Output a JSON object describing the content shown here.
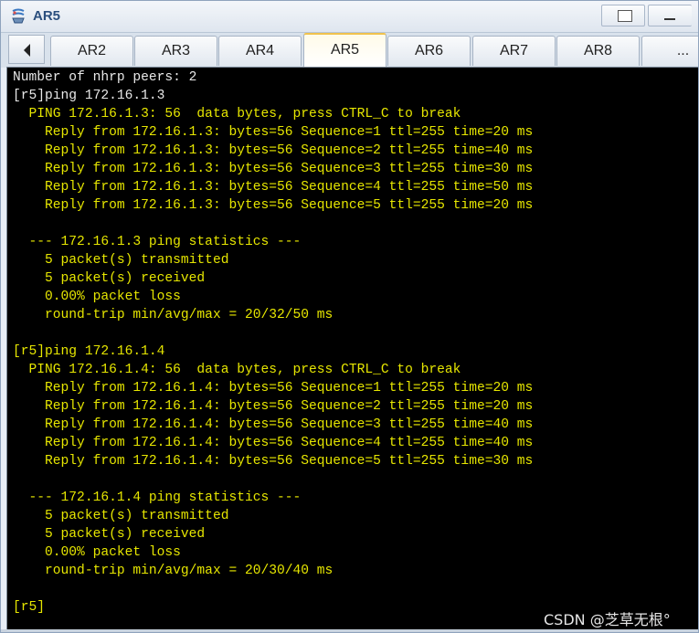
{
  "window": {
    "title": "AR5",
    "accent_color": "#f0c24d",
    "title_color": "#2b4f7e"
  },
  "tabs": [
    {
      "label": "AR2",
      "active": false
    },
    {
      "label": "AR3",
      "active": false
    },
    {
      "label": "AR4",
      "active": false
    },
    {
      "label": "AR5",
      "active": true
    },
    {
      "label": "AR6",
      "active": false
    },
    {
      "label": "AR7",
      "active": false
    },
    {
      "label": "AR8",
      "active": false
    },
    {
      "label": "...",
      "active": false
    }
  ],
  "terminal": {
    "background": "#000000",
    "lines": [
      {
        "text": "Number of nhrp peers: 2",
        "color": "white"
      },
      {
        "text": "[r5]ping 172.16.1.3",
        "color": "white"
      },
      {
        "text": "  PING 172.16.1.3: 56  data bytes, press CTRL_C to break",
        "color": "yellow"
      },
      {
        "text": "    Reply from 172.16.1.3: bytes=56 Sequence=1 ttl=255 time=20 ms",
        "color": "yellow"
      },
      {
        "text": "    Reply from 172.16.1.3: bytes=56 Sequence=2 ttl=255 time=40 ms",
        "color": "yellow"
      },
      {
        "text": "    Reply from 172.16.1.3: bytes=56 Sequence=3 ttl=255 time=30 ms",
        "color": "yellow"
      },
      {
        "text": "    Reply from 172.16.1.3: bytes=56 Sequence=4 ttl=255 time=50 ms",
        "color": "yellow"
      },
      {
        "text": "    Reply from 172.16.1.3: bytes=56 Sequence=5 ttl=255 time=20 ms",
        "color": "yellow"
      },
      {
        "text": "",
        "color": "yellow"
      },
      {
        "text": "  --- 172.16.1.3 ping statistics ---",
        "color": "yellow"
      },
      {
        "text": "    5 packet(s) transmitted",
        "color": "yellow"
      },
      {
        "text": "    5 packet(s) received",
        "color": "yellow"
      },
      {
        "text": "    0.00% packet loss",
        "color": "yellow"
      },
      {
        "text": "    round-trip min/avg/max = 20/32/50 ms",
        "color": "yellow"
      },
      {
        "text": "",
        "color": "yellow"
      },
      {
        "text": "[r5]ping 172.16.1.4",
        "color": "yellow"
      },
      {
        "text": "  PING 172.16.1.4: 56  data bytes, press CTRL_C to break",
        "color": "yellow"
      },
      {
        "text": "    Reply from 172.16.1.4: bytes=56 Sequence=1 ttl=255 time=20 ms",
        "color": "yellow"
      },
      {
        "text": "    Reply from 172.16.1.4: bytes=56 Sequence=2 ttl=255 time=20 ms",
        "color": "yellow"
      },
      {
        "text": "    Reply from 172.16.1.4: bytes=56 Sequence=3 ttl=255 time=40 ms",
        "color": "yellow"
      },
      {
        "text": "    Reply from 172.16.1.4: bytes=56 Sequence=4 ttl=255 time=40 ms",
        "color": "yellow"
      },
      {
        "text": "    Reply from 172.16.1.4: bytes=56 Sequence=5 ttl=255 time=30 ms",
        "color": "yellow"
      },
      {
        "text": "",
        "color": "yellow"
      },
      {
        "text": "  --- 172.16.1.4 ping statistics ---",
        "color": "yellow"
      },
      {
        "text": "    5 packet(s) transmitted",
        "color": "yellow"
      },
      {
        "text": "    5 packet(s) received",
        "color": "yellow"
      },
      {
        "text": "    0.00% packet loss",
        "color": "yellow"
      },
      {
        "text": "    round-trip min/avg/max = 20/30/40 ms",
        "color": "yellow"
      },
      {
        "text": "",
        "color": "yellow"
      },
      {
        "text": "[r5]",
        "color": "yellow"
      }
    ]
  },
  "watermark": "CSDN @芝草无根°",
  "icons": {
    "app": "network-device-icon",
    "scroll_left": "triangle-left-icon",
    "restore": "restore-window-icon",
    "minimize": "minimize-icon"
  }
}
